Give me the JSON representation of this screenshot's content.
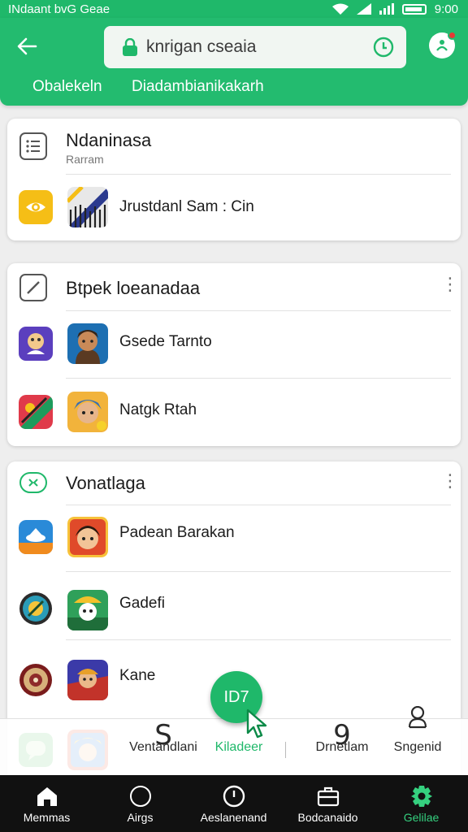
{
  "status_bar": {
    "left_text": "INdaant bvG Geae",
    "time": "9:00"
  },
  "header": {
    "search_text": "knrigan cseaia",
    "tabs": [
      "Obalekeln",
      "Diadambianikakarh"
    ]
  },
  "card1": {
    "title": "Ndaninasa",
    "subtitle": "Rarram",
    "rows": [
      {
        "label": "Jrustdanl Sam : Cin"
      }
    ]
  },
  "card2": {
    "title": "Btpek loeanadaa",
    "rows": [
      {
        "label": "Gsede Tarnto"
      },
      {
        "label": "Natgk Rtah"
      }
    ]
  },
  "card3": {
    "title": "Vonatlaga",
    "rows": [
      {
        "label": "Padean Barakan"
      },
      {
        "label": "Gadefi"
      },
      {
        "label": "Kane"
      }
    ]
  },
  "fab": {
    "label": "ID7"
  },
  "sub_tabs": [
    {
      "glyph": "S",
      "label": "Ventandlani"
    },
    {
      "glyph": "",
      "label": "Kiladeer"
    },
    {
      "glyph": "9",
      "label": "Drnetlam"
    },
    {
      "glyph": "",
      "label": "Sngenid"
    }
  ],
  "bottom_nav": [
    {
      "label": "Memmas"
    },
    {
      "label": "Airgs"
    },
    {
      "label": "Aeslanenand"
    },
    {
      "label": "Bodcanaido"
    },
    {
      "label": "Gelilae"
    }
  ],
  "colors": {
    "brand_green": "#23bb6f",
    "nav_bg": "#111111",
    "active_nav": "#35d07f",
    "badge_red": "#e53935"
  },
  "icons": {
    "header": [
      "back-arrow-icon",
      "lock-icon",
      "timer-icon",
      "avatar-icon"
    ],
    "cards": [
      "list-icon",
      "edit-icon",
      "controller-icon"
    ],
    "bottom_nav": [
      "home-icon",
      "circle-icon",
      "clock-icon",
      "briefcase-icon",
      "gear-icon"
    ]
  }
}
